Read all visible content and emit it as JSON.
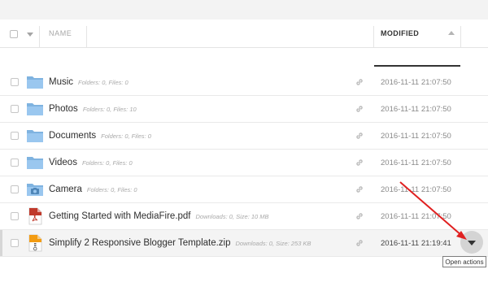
{
  "header": {
    "name_label": "NAME",
    "modified_label": "MODIFIED"
  },
  "files": [
    {
      "title": "Music",
      "meta": "Folders: 0, Files: 0",
      "date": "2016-11-11 21:07:50",
      "icon": "folder-icon"
    },
    {
      "title": "Photos",
      "meta": "Folders: 0, Files: 10",
      "date": "2016-11-11 21:07:50",
      "icon": "folder-icon"
    },
    {
      "title": "Documents",
      "meta": "Folders: 0, Files: 0",
      "date": "2016-11-11 21:07:50",
      "icon": "folder-icon"
    },
    {
      "title": "Videos",
      "meta": "Folders: 0, Files: 0",
      "date": "2016-11-11 21:07:50",
      "icon": "folder-icon"
    },
    {
      "title": "Camera",
      "meta": "Folders: 0, Files: 0",
      "date": "2016-11-11 21:07:50",
      "icon": "camera-folder-icon"
    },
    {
      "title": "Getting Started with MediaFire.pdf",
      "meta": "Downloads: 0, Size: 10 MB",
      "date": "2016-11-11 21:07:50",
      "icon": "pdf-file-icon"
    },
    {
      "title": "Simplify 2 Responsive Blogger Template.zip",
      "meta": "Downloads: 0, Size: 253 KB",
      "date": "2016-11-11 21:19:41",
      "icon": "zip-file-icon"
    }
  ],
  "actions": {
    "tooltip": "Open actions"
  },
  "colors": {
    "folder": "#8fbde8",
    "pdf": "#c0392b",
    "zip": "#f39c12",
    "annotation_arrow": "#e02020"
  }
}
